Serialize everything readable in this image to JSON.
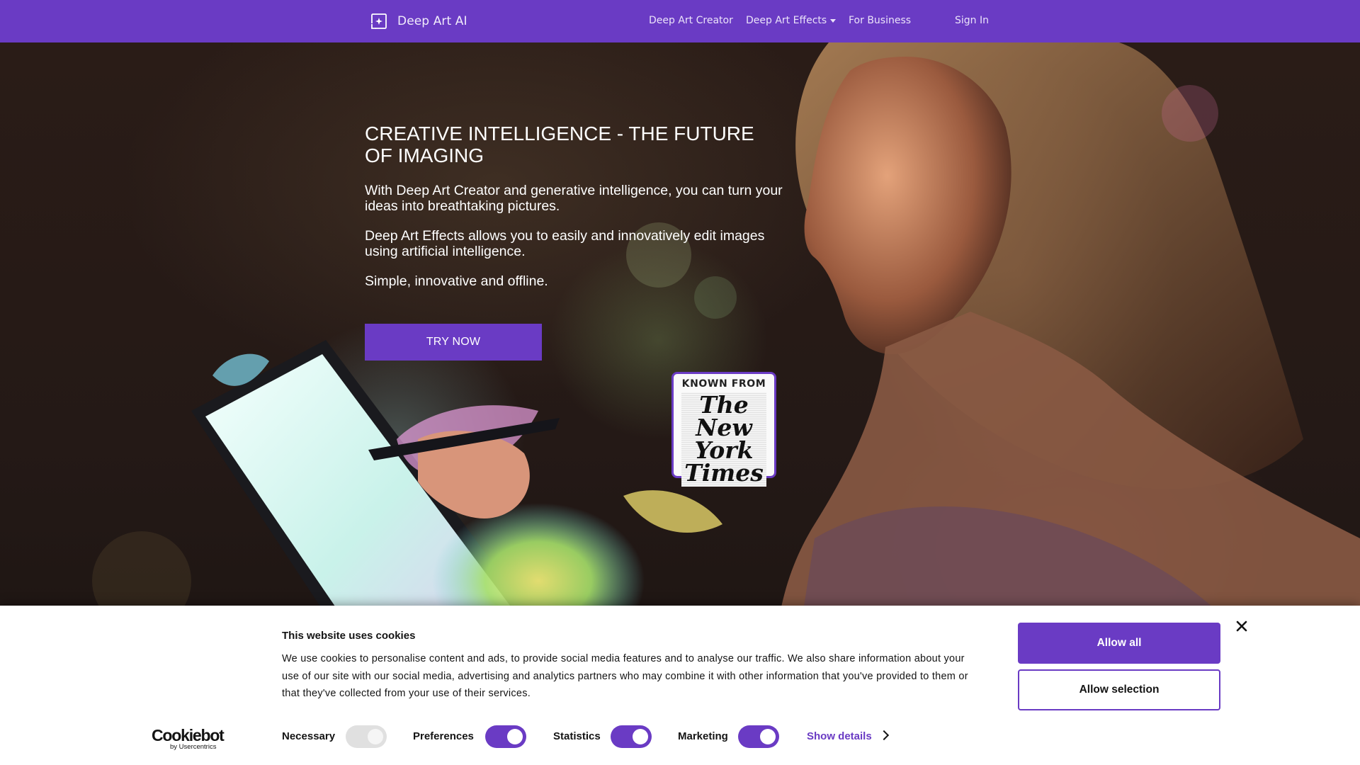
{
  "nav": {
    "brand": "Deep Art AI",
    "links": [
      "Deep Art Creator",
      "Deep Art Effects",
      "For Business"
    ],
    "sign_in": "Sign In"
  },
  "hero": {
    "title": "CREATIVE INTELLIGENCE - THE FUTURE OF IMAGING",
    "paragraphs": [
      "With Deep Art Creator and generative intelligence, you can turn your ideas into breathtaking pictures.",
      "Deep Art Effects allows you to easily and innovatively edit images using artificial intelligence.",
      "Simple, innovative and offline."
    ],
    "cta": "TRY NOW",
    "badge": {
      "heading": "KNOWN FROM",
      "logo_text": "The New York Times"
    }
  },
  "cookie_banner": {
    "provider_logo": "Cookiebot",
    "provider_sub": "by Usercentrics",
    "title": "This website uses cookies",
    "text": "We use cookies to personalise content and ads, to provide social media features and to analyse our traffic. We also share information about your use of our site with our social media, advertising and analytics partners who may combine it with other information that you've provided to them or that they've collected from your use of their services.",
    "toggles": [
      {
        "label": "Necessary",
        "checked": true,
        "disabled": true
      },
      {
        "label": "Preferences",
        "checked": true,
        "disabled": false
      },
      {
        "label": "Statistics",
        "checked": true,
        "disabled": false
      },
      {
        "label": "Marketing",
        "checked": true,
        "disabled": false
      }
    ],
    "show_details": "Show details",
    "allow_all": "Allow all",
    "allow_selection": "Allow selection"
  },
  "colors": {
    "brand_purple": "#6a3bc4",
    "banner_text": "#141414"
  },
  "icons": [
    "brand-logo-icon",
    "caret-down-icon",
    "chevron-right-icon",
    "close-icon"
  ]
}
